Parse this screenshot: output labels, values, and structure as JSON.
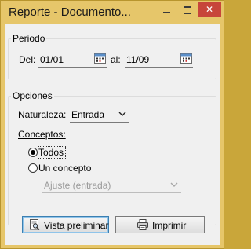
{
  "window": {
    "title": "Reporte - Documento..."
  },
  "periodo": {
    "group_title": "Periodo",
    "del_label": "Del:",
    "del_value": "01/01",
    "al_label": "al:",
    "al_value": "11/09"
  },
  "opciones": {
    "group_title": "Opciones",
    "naturaleza_label": "Naturaleza:",
    "naturaleza_value": "Entrada",
    "conceptos_label": "Conceptos:",
    "radio_todos_label": "Todos",
    "radio_todos_selected": true,
    "radio_un_concepto_label": "Un concepto",
    "concepto_value": "Ajuste (entrada)"
  },
  "buttons": {
    "preview_label": "Vista preliminar",
    "print_label": "Imprimir"
  },
  "colors": {
    "title_bar": "#e6c66a",
    "close_button": "#c7453a",
    "client_bg": "#f0f0f0"
  }
}
